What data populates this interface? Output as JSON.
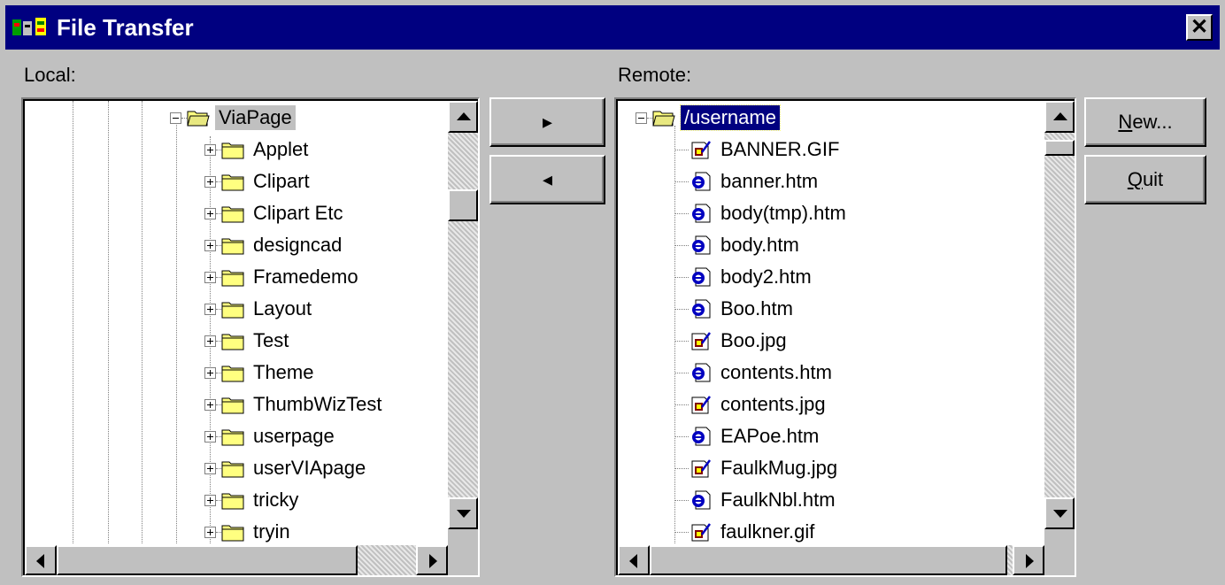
{
  "window": {
    "title": "File Transfer",
    "close_glyph": "✕"
  },
  "local": {
    "label": "Local:",
    "selected": "ViaPage",
    "children": [
      "Applet",
      "Clipart",
      "Clipart Etc",
      "designcad",
      "Framedemo",
      "Layout",
      "Test",
      "Theme",
      "ThumbWizTest",
      "userpage",
      "userVIApage",
      "tricky",
      "tryin"
    ]
  },
  "remote": {
    "label": "Remote:",
    "root": "/username",
    "files": [
      {
        "name": "BANNER.GIF",
        "type": "image"
      },
      {
        "name": "banner.htm",
        "type": "html"
      },
      {
        "name": "body(tmp).htm",
        "type": "html"
      },
      {
        "name": "body.htm",
        "type": "html"
      },
      {
        "name": "body2.htm",
        "type": "html"
      },
      {
        "name": "Boo.htm",
        "type": "html"
      },
      {
        "name": "Boo.jpg",
        "type": "image"
      },
      {
        "name": "contents.htm",
        "type": "html"
      },
      {
        "name": "contents.jpg",
        "type": "image"
      },
      {
        "name": "EAPoe.htm",
        "type": "html"
      },
      {
        "name": "FaulkMug.jpg",
        "type": "image"
      },
      {
        "name": "FaulkNbl.htm",
        "type": "html"
      },
      {
        "name": "faulkner.gif",
        "type": "image"
      }
    ]
  },
  "buttons": {
    "upload_glyph": "▸",
    "download_glyph": "◂",
    "new_key": "N",
    "new_rest": "ew...",
    "quit_key": "Q",
    "quit_rest": "uit"
  },
  "colors": {
    "title_bar": "#000080",
    "face": "#c0c0c0",
    "selection": "#000080",
    "folder": "#ffff80"
  }
}
